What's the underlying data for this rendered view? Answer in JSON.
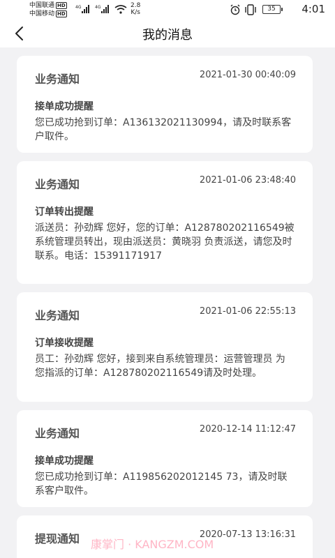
{
  "statusbar": {
    "carrier1": "中国联通",
    "carrier2": "中国移动",
    "hd": "HD",
    "net1": "4G",
    "net2": "4G",
    "speed_value": "2.8",
    "speed_unit": "K/s",
    "battery": "35",
    "time": "4:01"
  },
  "navbar": {
    "title": "我的消息"
  },
  "messages": [
    {
      "type": "业务通知",
      "date": "2021-01-30 00:40:09",
      "subtitle": "接单成功提醒",
      "body": "您已成功抢到订单：A136132021130994，请及时联系客户取件。"
    },
    {
      "type": "业务通知",
      "date": "2021-01-06 23:48:40",
      "subtitle": "订单转出提醒",
      "body": "派送员：孙劲辉 您好，您的订单：A128780202116549被系统管理员转出，现由派送员：黄晓羽 负责派送，请您及时联系。电话：15391171917"
    },
    {
      "type": "业务通知",
      "date": "2021-01-06 22:55:13",
      "subtitle": "订单接收提醒",
      "body": "员工：孙劲辉 您好，接到来自系统管理员：运营管理员 为您指派的订单：A128780202116549请及时处理。"
    },
    {
      "type": "业务通知",
      "date": "2020-12-14 11:12:47",
      "subtitle": "接单成功提醒",
      "body": "您已成功抢到订单：A119856202012145 73，请及时联系客户取件。"
    },
    {
      "type": "提现通知",
      "date": "2020-07-13 13:16:31",
      "subtitle": "",
      "body": ""
    }
  ],
  "watermark": "康掌门 · KANGZM.COM",
  "icons": {
    "back": "back-arrow-icon",
    "alarm": "alarm-icon",
    "vibrate": "vibrate-icon",
    "wifi": "wifi-icon",
    "signal": "signal-icon"
  }
}
